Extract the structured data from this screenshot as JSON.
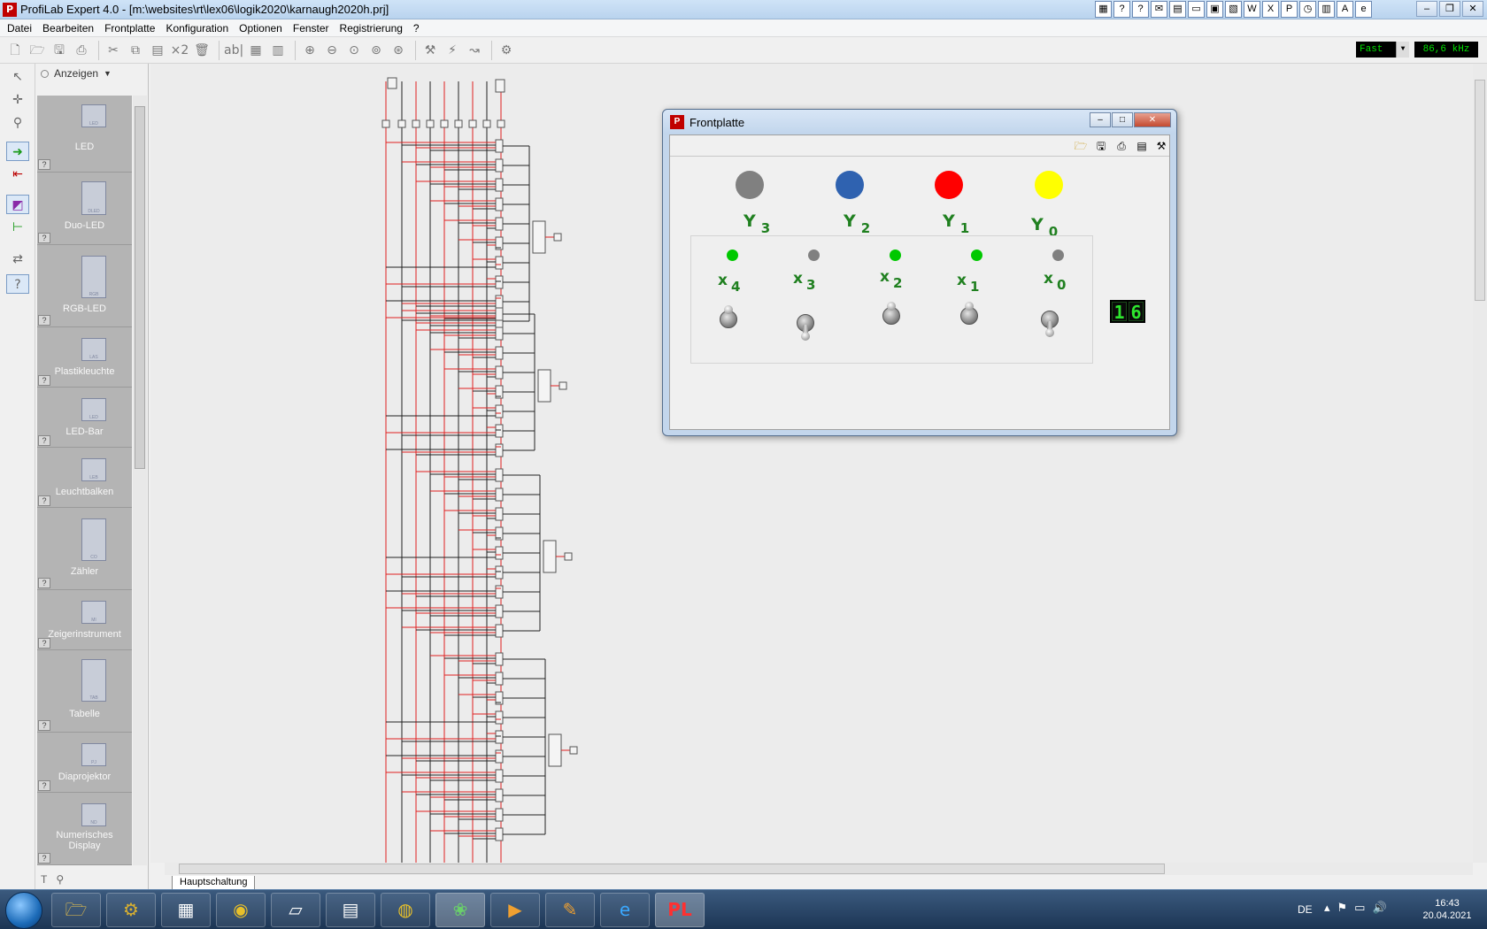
{
  "window": {
    "title": "ProfiLab Expert 4.0 - [m:\\websites\\rt\\lex06\\logik2020\\karnaugh2020h.prj]",
    "app_icon_text": "P"
  },
  "menu": [
    "Datei",
    "Bearbeiten",
    "Frontplatte",
    "Konfiguration",
    "Optionen",
    "Fenster",
    "Registrierung",
    "?"
  ],
  "toolbar": {
    "format_x2_label": "×2",
    "text_tool_label": "ab|",
    "speed_value": "Fast",
    "frequency_value": "86,6 kHz"
  },
  "library": {
    "filter_label": "Anzeigen",
    "help_mark": "?",
    "items": [
      {
        "label": "LED",
        "tag": "LED"
      },
      {
        "label": "Duo-LED",
        "tag": "DLED"
      },
      {
        "label": "RGB-LED",
        "tag": "RGB"
      },
      {
        "label": "Plastikleuchte",
        "tag": "LAS"
      },
      {
        "label": "LED-Bar",
        "tag": "LED"
      },
      {
        "label": "Leuchtbalken",
        "tag": "LEB"
      },
      {
        "label": "Zähler",
        "tag": "CO"
      },
      {
        "label": "Zeigerinstrument",
        "tag": "MI"
      },
      {
        "label": "Tabelle",
        "tag": "TAB"
      },
      {
        "label": "Diaprojektor",
        "tag": "PJ"
      },
      {
        "label": "Numerisches Display",
        "tag": "ND"
      }
    ],
    "footer_text_tool": "T",
    "footer_search_tool": "⚲"
  },
  "canvas": {
    "sheet_tab": "Hauptschaltung"
  },
  "frontplatte": {
    "title": "Frontplatte",
    "outputs": [
      {
        "name": "Y",
        "index": "3",
        "color": "#808080"
      },
      {
        "name": "Y",
        "index": "2",
        "color": "#2f62b0"
      },
      {
        "name": "Y",
        "index": "1",
        "color": "#ff0000"
      },
      {
        "name": "Y",
        "index": "0",
        "color": "#ffff00"
      }
    ],
    "inputs": [
      {
        "name": "x",
        "index": "4",
        "led_color": "#00c800",
        "state": "on"
      },
      {
        "name": "x",
        "index": "3",
        "led_color": "#808080",
        "state": "off"
      },
      {
        "name": "x",
        "index": "2",
        "led_color": "#00c800",
        "state": "on"
      },
      {
        "name": "x",
        "index": "1",
        "led_color": "#00c800",
        "state": "on"
      },
      {
        "name": "x",
        "index": "0",
        "led_color": "#808080",
        "state": "off"
      }
    ],
    "number_digits": [
      "1",
      "6"
    ]
  },
  "taskbar": {
    "language": "DE",
    "time": "16:43",
    "date": "20.04.2021"
  }
}
